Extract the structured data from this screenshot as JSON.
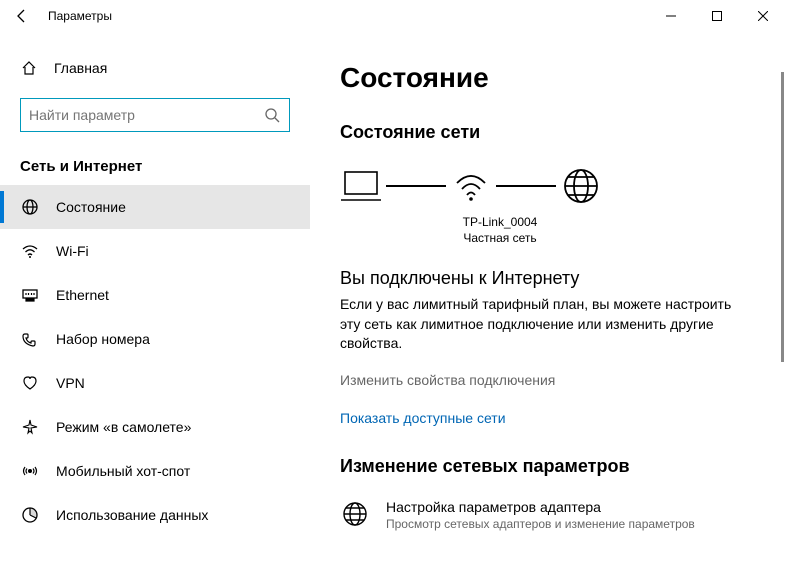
{
  "titlebar": {
    "title": "Параметры"
  },
  "sidebar": {
    "home": "Главная",
    "search_placeholder": "Найти параметр",
    "section": "Сеть и Интернет",
    "items": [
      {
        "label": "Состояние"
      },
      {
        "label": "Wi-Fi"
      },
      {
        "label": "Ethernet"
      },
      {
        "label": "Набор номера"
      },
      {
        "label": "VPN"
      },
      {
        "label": "Режим «в самолете»"
      },
      {
        "label": "Мобильный хот-спот"
      },
      {
        "label": "Использование данных"
      }
    ]
  },
  "main": {
    "heading": "Состояние",
    "sub_heading": "Состояние сети",
    "net_name": "TP-Link_0004",
    "net_type": "Частная сеть",
    "connected_title": "Вы подключены к Интернету",
    "connected_desc": "Если у вас лимитный тарифный план, вы можете настроить эту сеть как лимитное подключение или изменить другие свойства.",
    "link_props": "Изменить свойства подключения",
    "link_nets": "Показать доступные сети",
    "change_heading": "Изменение сетевых параметров",
    "adapter_title": "Настройка параметров адаптера",
    "adapter_desc": "Просмотр сетевых адаптеров и изменение параметров"
  }
}
